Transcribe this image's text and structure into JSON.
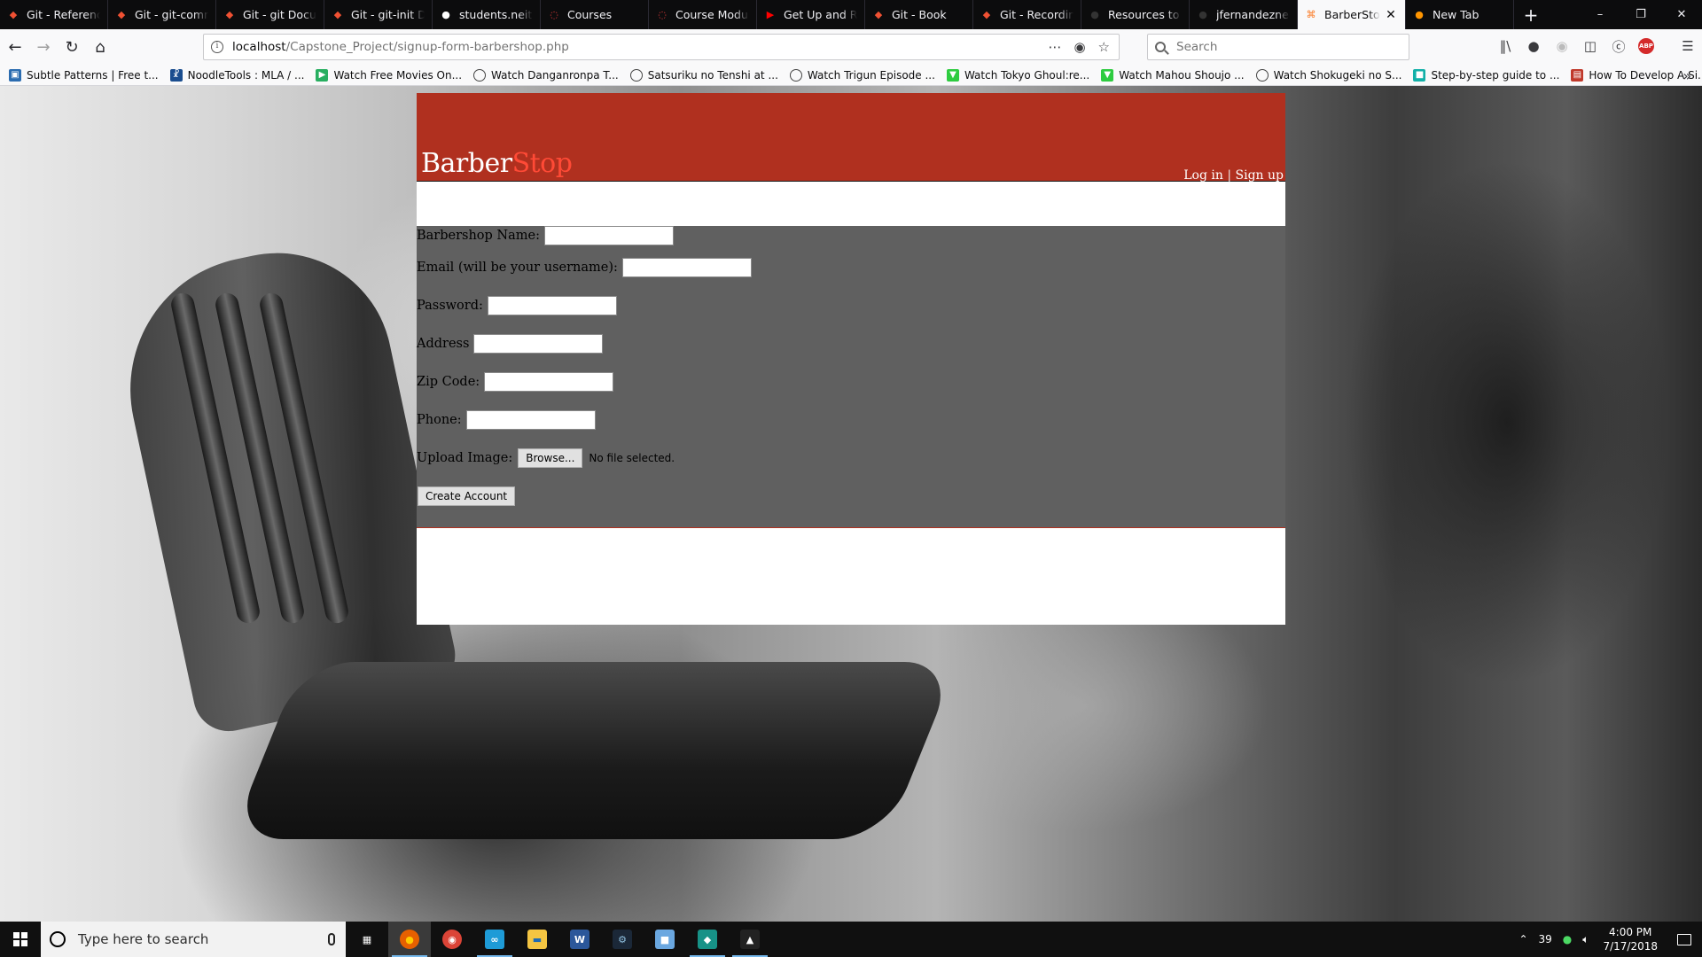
{
  "browser": {
    "tabs": [
      {
        "title": "Git - Reference",
        "icon": "git-icon",
        "color": "#f05133"
      },
      {
        "title": "Git - git-comm",
        "icon": "git-icon",
        "color": "#f05133"
      },
      {
        "title": "Git - git Docum",
        "icon": "git-icon",
        "color": "#f05133"
      },
      {
        "title": "Git - git-init Do",
        "icon": "git-icon",
        "color": "#f05133"
      },
      {
        "title": "students.neit.e",
        "icon": "neit-icon",
        "color": "#ffffff"
      },
      {
        "title": "Courses",
        "icon": "courses-icon",
        "color": "#e03a3a"
      },
      {
        "title": "Course Module",
        "icon": "courses-icon",
        "color": "#e03a3a"
      },
      {
        "title": "Get Up and Ru",
        "icon": "youtube-icon",
        "color": "#ff0000"
      },
      {
        "title": "Git - Book",
        "icon": "git-icon",
        "color": "#f05133"
      },
      {
        "title": "Git - Recording",
        "icon": "git-icon",
        "color": "#f05133"
      },
      {
        "title": "Resources to le",
        "icon": "github-icon",
        "color": "#333333"
      },
      {
        "title": "jfernandezneit/",
        "icon": "github-icon",
        "color": "#333333"
      },
      {
        "title": "BarberStop",
        "icon": "xampp-icon",
        "color": "#fb7a24",
        "active": true
      },
      {
        "title": "New Tab",
        "icon": "firefox-icon",
        "color": "#ff9500"
      }
    ],
    "url_host": "localhost",
    "url_path": "/Capstone_Project/signup-form-barbershop.php",
    "search_placeholder": "Search",
    "bookmarks": [
      {
        "label": "Subtle Patterns | Free t...",
        "icon": "subtle-patterns-icon",
        "color": "#2b6cb0"
      },
      {
        "label": "NoodleTools : MLA / ...",
        "icon": "noodletools-icon",
        "color": "#1a4d8f"
      },
      {
        "label": "Watch Free Movies On...",
        "icon": "play-icon",
        "color": "#27ae60"
      },
      {
        "label": "Watch Danganronpa T...",
        "icon": "globe-icon"
      },
      {
        "label": "Satsuriku no Tenshi at ...",
        "icon": "globe-icon"
      },
      {
        "label": "Watch Trigun Episode ...",
        "icon": "globe-icon"
      },
      {
        "label": "Watch Tokyo Ghoul:re...",
        "icon": "anime-icon",
        "color": "#2ecc40"
      },
      {
        "label": "Watch Mahou Shoujo ...",
        "icon": "anime-icon",
        "color": "#2ecc40"
      },
      {
        "label": "Watch Shokugeki no S...",
        "icon": "globe-icon"
      },
      {
        "label": "Step-by-step guide to ...",
        "icon": "guide-icon",
        "color": "#12b0a8"
      },
      {
        "label": "How To Develop A Si...",
        "icon": "book-icon",
        "color": "#c0392b"
      }
    ]
  },
  "site": {
    "logo_part1": "Barber",
    "logo_part2": "Stop",
    "login_link": "Log in",
    "separator": "|",
    "signup_link": "Sign up",
    "colors": {
      "header": "#b0301f",
      "logo_accent": "#ff4a36",
      "form_bg": "#606060"
    },
    "form": {
      "barbershop_name_label": "Barbershop Name:",
      "email_label": "Email (will be your username):",
      "password_label": "Password:",
      "address_label": "Address",
      "zip_label": "Zip Code:",
      "phone_label": "Phone:",
      "upload_label": "Upload Image:",
      "browse_button": "Browse...",
      "no_file_text": "No file selected.",
      "submit_button": "Create Account"
    }
  },
  "taskbar": {
    "search_placeholder": "Type here to search",
    "apps": [
      "task-view-icon",
      "firefox-icon",
      "chrome-icon",
      "visual-studio-icon",
      "file-explorer-icon",
      "word-icon",
      "steam-icon",
      "virtualbox-icon",
      "gitkraken-icon",
      "photos-icon"
    ],
    "tray_temp": "39",
    "time": "4:00 PM",
    "date": "7/17/2018"
  }
}
